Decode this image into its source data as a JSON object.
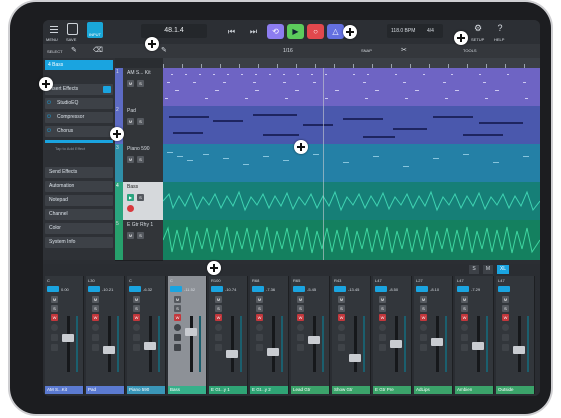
{
  "topbar": {
    "menu_label": "MENU",
    "save_label": "SAVE",
    "input_label": "INPUT",
    "position": "48.1.4",
    "tempo": "118.0 BPM",
    "signature": "4/4",
    "setup_label": "SETUP",
    "help_label": "HELP"
  },
  "toolbar2": {
    "select_label": "SELECT",
    "draw_label": "DRAW",
    "quantize_value": "1/16",
    "snap_label": "SNAP",
    "tools_label": "TOOLS"
  },
  "inspector": {
    "track_name": "4 Bass",
    "insert_header": "Insert Effects",
    "effects": [
      "StudioEQ",
      "Compressor",
      "Chorus"
    ],
    "add_effect": "Tap to Add Effect",
    "sections": [
      "Send Effects",
      "Automation",
      "Notepad",
      "Channel",
      "Color",
      "System Info"
    ]
  },
  "tracks": [
    {
      "num": "1",
      "name": "AM S... Kit",
      "color": "#5d6bc4"
    },
    {
      "num": "2",
      "name": "Pad",
      "color": "#5d6bc4"
    },
    {
      "num": "3",
      "name": "Piano 590",
      "color": "#2f8fa8"
    },
    {
      "num": "4",
      "name": "Bass",
      "color": "#2aa57f"
    },
    {
      "num": "5",
      "name": "E Gtr Rhy 1",
      "color": "#27a06c"
    }
  ],
  "mixer": {
    "tabs": [
      "S",
      "M",
      "XL"
    ],
    "channels": [
      {
        "name": "AM S...Kit",
        "pan": "C",
        "vol": "0.00",
        "color": "#5b7ad1"
      },
      {
        "name": "Pad",
        "pan": "L30",
        "vol": "-10.21",
        "color": "#5b7ad1"
      },
      {
        "name": "Piano 590",
        "pan": "C",
        "vol": "-6.32",
        "color": "#3a96b8"
      },
      {
        "name": "Bass",
        "pan": "C",
        "vol": "-11.52",
        "color": "#36b08a"
      },
      {
        "name": "E Gt...y 1",
        "pan": "R100",
        "vol": "-10.74",
        "color": "#2fa475"
      },
      {
        "name": "E Gt...y 2",
        "pan": "R68",
        "vol": "-7.36",
        "color": "#2fa475"
      },
      {
        "name": "Lead Gtr",
        "pan": "R65",
        "vol": "-5.45",
        "color": "#3ba36a"
      },
      {
        "name": "Show Gtr",
        "pan": "R43",
        "vol": "-13.45",
        "color": "#3ba36a"
      },
      {
        "name": "E Gtr Pre",
        "pan": "L47",
        "vol": "-8.50",
        "color": "#3ba36a"
      },
      {
        "name": "AdLips",
        "pan": "L27",
        "vol": "-8.10",
        "color": "#3ba36a"
      },
      {
        "name": "Ambien",
        "pan": "L47",
        "vol": "-7.29",
        "color": "#3ba36a"
      },
      {
        "name": "Outside",
        "pan": "L47",
        "vol": "",
        "color": "#3ba36a"
      }
    ]
  }
}
